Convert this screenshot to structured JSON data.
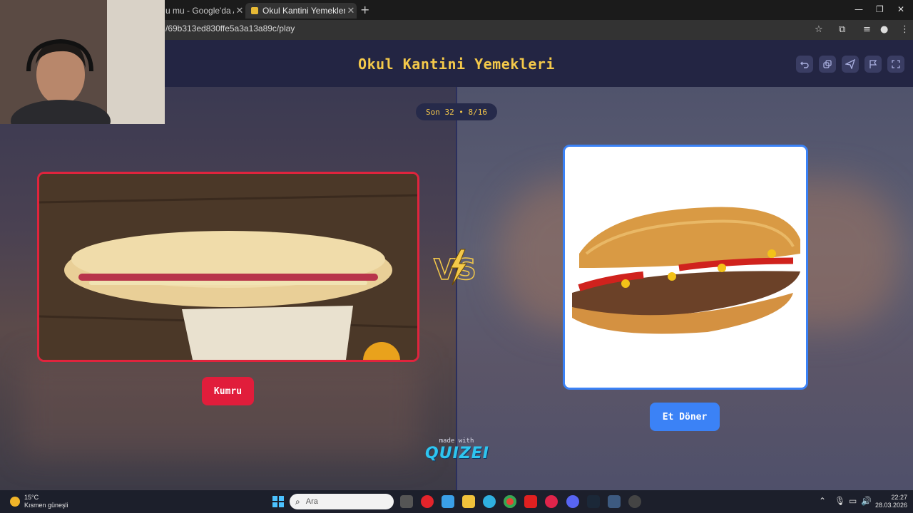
{
  "browser": {
    "tabs": [
      {
        "label": "u mu - Google'da Ara"
      },
      {
        "label": "Okul Kantini Yemekleri - Tier Lis"
      }
    ],
    "url": "/69b313ed830ffe5a3a13a89c/play"
  },
  "page": {
    "title": "Okul Kantini Yemekleri",
    "round": "Son 32 • 8/16",
    "left_option": {
      "label": "Kumru"
    },
    "right_option": {
      "label": "Et Döner"
    },
    "vs_text": "VS",
    "footer_made": "made with",
    "footer_brand": "QUIZEI",
    "header_buttons": [
      "undo-icon",
      "copy-icon",
      "share-icon",
      "flag-icon",
      "fullscreen-icon"
    ]
  },
  "taskbar": {
    "weather_temp": "15°C",
    "weather_desc": "Kısmen güneşli",
    "search_placeholder": "Ara",
    "time": "22:27",
    "date": "28.03.2026"
  },
  "colors": {
    "accent_yellow": "#f4c94a",
    "left_red": "#e11d3b",
    "right_blue": "#3b82f6",
    "header_bg": "#232543"
  }
}
